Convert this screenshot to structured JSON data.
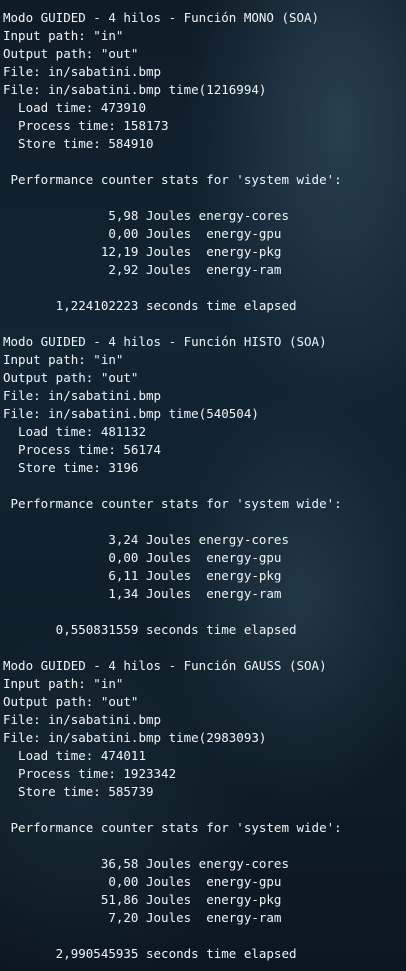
{
  "terminal": {
    "lines": [
      "Modo GUIDED - 4 hilos - Función MONO (SOA)",
      "Input path: \"in\"",
      "Output path: \"out\"",
      "File: in/sabatini.bmp",
      "File: in/sabatini.bmp time(1216994)",
      "  Load time: 473910",
      "  Process time: 158173",
      "  Store time: 584910",
      "",
      " Performance counter stats for 'system wide':",
      "",
      "              5,98 Joules energy-cores",
      "              0,00 Joules  energy-gpu",
      "             12,19 Joules  energy-pkg",
      "              2,92 Joules  energy-ram",
      "",
      "       1,224102223 seconds time elapsed",
      "",
      "Modo GUIDED - 4 hilos - Función HISTO (SOA)",
      "Input path: \"in\"",
      "Output path: \"out\"",
      "File: in/sabatini.bmp",
      "File: in/sabatini.bmp time(540504)",
      "  Load time: 481132",
      "  Process time: 56174",
      "  Store time: 3196",
      "",
      " Performance counter stats for 'system wide':",
      "",
      "              3,24 Joules energy-cores",
      "              0,00 Joules  energy-gpu",
      "              6,11 Joules  energy-pkg",
      "              1,34 Joules  energy-ram",
      "",
      "       0,550831559 seconds time elapsed",
      "",
      "Modo GUIDED - 4 hilos - Función GAUSS (SOA)",
      "Input path: \"in\"",
      "Output path: \"out\"",
      "File: in/sabatini.bmp",
      "File: in/sabatini.bmp time(2983093)",
      "  Load time: 474011",
      "  Process time: 1923342",
      "  Store time: 585739",
      "",
      " Performance counter stats for 'system wide':",
      "",
      "             36,58 Joules energy-cores",
      "              0,00 Joules  energy-gpu",
      "             51,86 Joules  energy-pkg",
      "              7,20 Joules  energy-ram",
      "",
      "       2,990545935 seconds time elapsed"
    ]
  }
}
